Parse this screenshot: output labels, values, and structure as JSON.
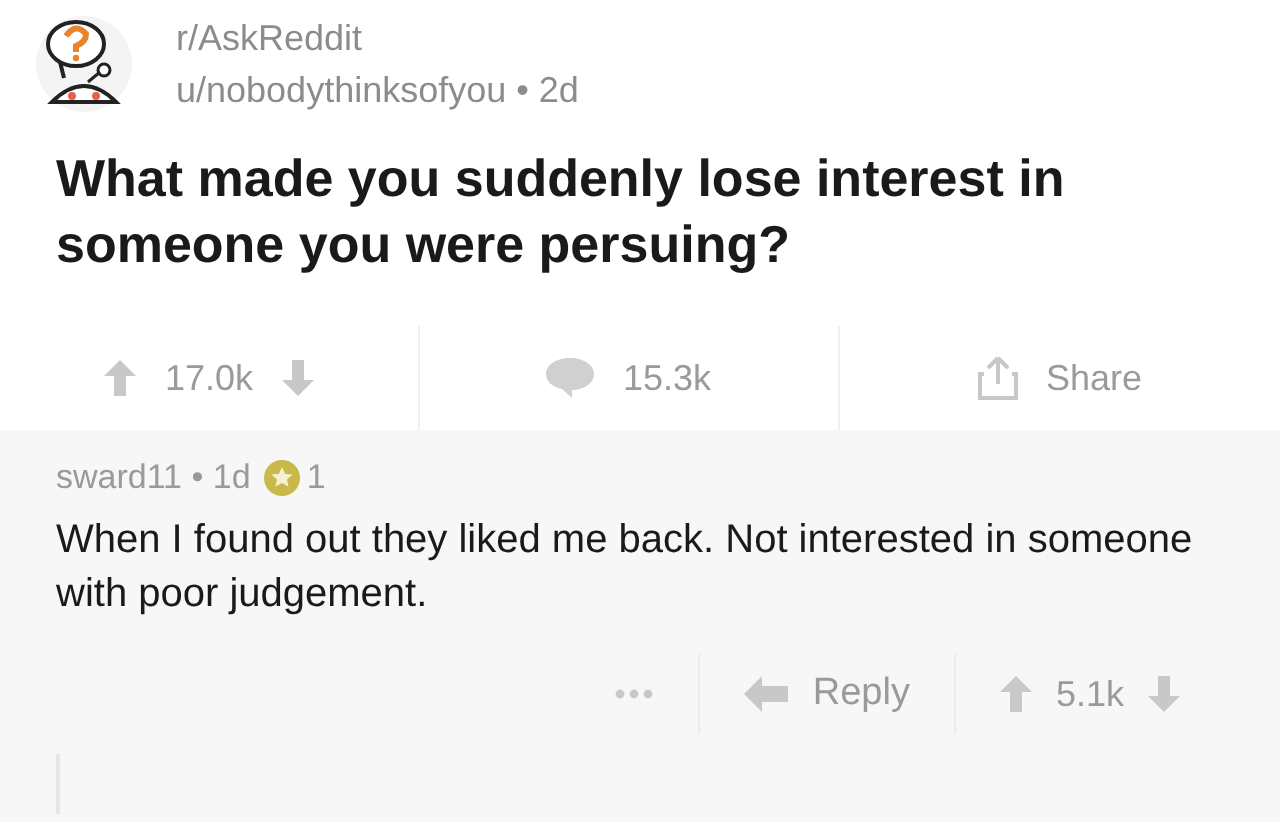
{
  "post": {
    "subreddit": "r/AskReddit",
    "byline": "u/nobodythinksofyou • 2d",
    "title": "What made you suddenly lose interest in someone you were persuing?",
    "actions": {
      "score": "17.0k",
      "comments": "15.3k",
      "share": "Share"
    }
  },
  "comment": {
    "byline": "sward11 • 1d",
    "awards": "1",
    "body": "When I found out they liked me back. Not interested in someone with poor judgement.",
    "reply": "Reply",
    "score": "5.1k"
  }
}
